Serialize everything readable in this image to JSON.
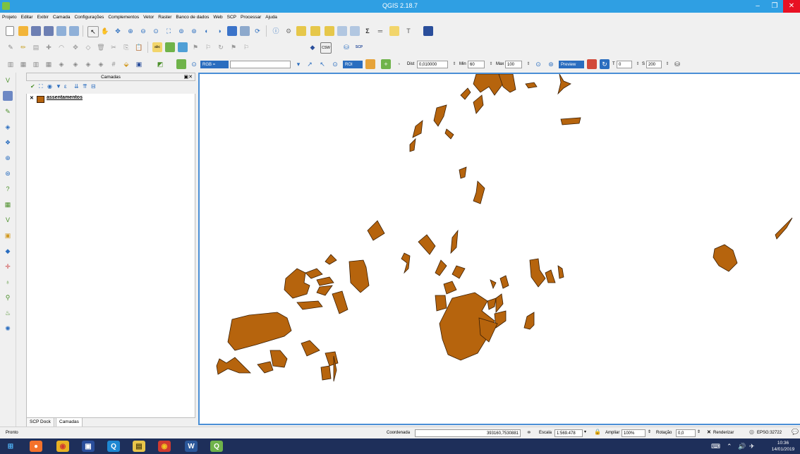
{
  "window": {
    "title": "QGIS 2.18.7",
    "minimize_glyph": "–",
    "restore_glyph": "❐",
    "close_glyph": "✕"
  },
  "menubar": {
    "items": [
      "Projeto",
      "Editar",
      "Exibir",
      "Camada",
      "Configurações",
      "Complementos",
      "Vetor",
      "Raster",
      "Banco de dados",
      "Web",
      "SCP",
      "Processar",
      "Ajuda"
    ]
  },
  "scp_toolbar": {
    "rgb_label": "RGB =",
    "roi_label": "ROI",
    "dist_label": "Dist",
    "dist_value": "0,010000",
    "min_label": "Min",
    "min_value": "60",
    "max_label": "Max",
    "max_value": "100",
    "preview_label": "Preview",
    "t_label": "T",
    "t_value": "0",
    "s_label": "S",
    "s_value": "200"
  },
  "layers_panel": {
    "title": "Camadas",
    "layers": [
      {
        "name": "assentamentos",
        "checked": true,
        "color": "#b6640d"
      }
    ]
  },
  "dock_tabs": [
    "SCP Dock",
    "Camadas"
  ],
  "statusbar": {
    "ready": "Pronto",
    "coord_label": "Coordenada",
    "coord_value": "393160,7530881",
    "scale_label": "Escala",
    "scale_value": "1:569.478",
    "magnify_label": "Ampliar",
    "magnify_value": "100%",
    "rotation_label": "Rotação",
    "rotation_value": "0,0",
    "render_label": "Renderizar",
    "crs_label": "EPSG:32722"
  },
  "taskbar": {
    "time": "10:36",
    "date": "14/01/2019"
  },
  "colors": {
    "titlebar": "#2f9fe3",
    "polygon_fill": "#b6640d",
    "polygon_stroke": "#3a1e04",
    "canvas_border": "#4a8fd6",
    "taskbar": "#1e2f5a"
  }
}
